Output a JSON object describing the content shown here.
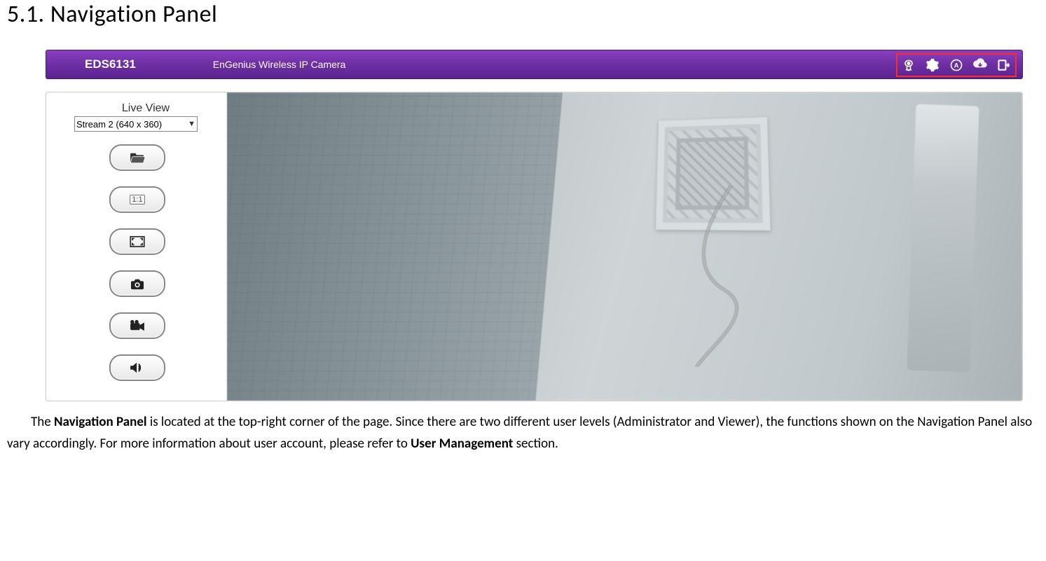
{
  "heading": "5.1.  Navigation Panel",
  "screenshot": {
    "nav": {
      "model": "EDS6131",
      "description": "EnGenius Wireless IP Camera",
      "icons": [
        {
          "name": "camera-icon"
        },
        {
          "name": "gear-icon"
        },
        {
          "name": "admin-icon"
        },
        {
          "name": "download-icon"
        },
        {
          "name": "logout-icon"
        }
      ]
    },
    "live_view": {
      "label": "Live View",
      "stream_selected": "Stream 2 (640 x 360)",
      "controls": [
        {
          "name": "folder-open-button"
        },
        {
          "name": "actual-size-button",
          "text": "1:1"
        },
        {
          "name": "fullscreen-button"
        },
        {
          "name": "snapshot-button"
        },
        {
          "name": "record-button"
        },
        {
          "name": "audio-button"
        }
      ]
    }
  },
  "paragraph": {
    "p1a": "The ",
    "p1b": "Navigation Panel",
    "p1c": " is located at the top-right corner of the page. Since there are two different user levels (Administrator and Viewer), the functions shown on the Navigation Panel also vary accordingly. For more information about user account, please refer to ",
    "p1d": "User Management",
    "p1e": " section."
  }
}
